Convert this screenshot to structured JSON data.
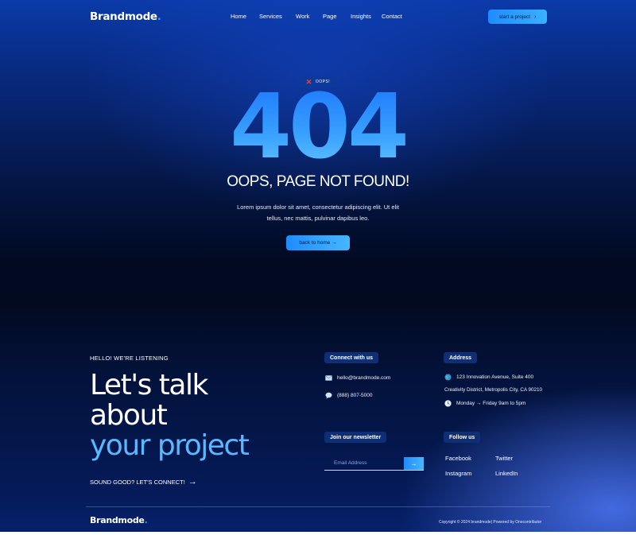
{
  "header": {
    "logo": "Brandmode",
    "logo_dot": ".",
    "nav": [
      "Home",
      "Services",
      "Work",
      "Page",
      "Insights",
      "Contact"
    ],
    "cta_label": "start a project",
    "cta_icon": "chevron-right-icon"
  },
  "hero": {
    "badge_label": "OOPS!",
    "badge_icon": "x-icon",
    "code": "404",
    "headline": "OOPS, PAGE NOT FOUND!",
    "body_line1": "Lorem ipsum dolor sit amet, consectetur adipiscing elit. Ut elit",
    "body_line2": "tellus, nec mattis, pulvinar dapibus leo.",
    "button_label": "back to home →"
  },
  "footer": {
    "hello": "HELLO! WE'RE LISTENING",
    "title_line1": "Let's talk",
    "title_line2": "about",
    "title_line3": "your project",
    "sound_label": "SOUND GOOD? LET'S CONNECT!",
    "connect": {
      "title": "Connect with us",
      "email": "hello@brandmode.com",
      "phone": "(888) 807-5000"
    },
    "address": {
      "title": "Address",
      "line1": "123 Innovation Avenue, Suite 400",
      "line2": "Creativity District, Metropolis City, CA 90210",
      "hours": "Monday → Friday 9am to 5pm"
    },
    "newsletter": {
      "title": "Join our newsletter",
      "placeholder": "Email Address"
    },
    "follow": {
      "title": "Follow us",
      "links": [
        "Facebook",
        "Twitter",
        "Instagram",
        "LinkedIn"
      ]
    },
    "bottom_logo": "Brandmode",
    "copyright": "Copyright © 2024 brandmode| Powered by Onecontributor"
  },
  "colors": {
    "accent": "#1f8cff",
    "accent_light": "#5ab8ff",
    "badge_x": "#ff3b3b"
  }
}
